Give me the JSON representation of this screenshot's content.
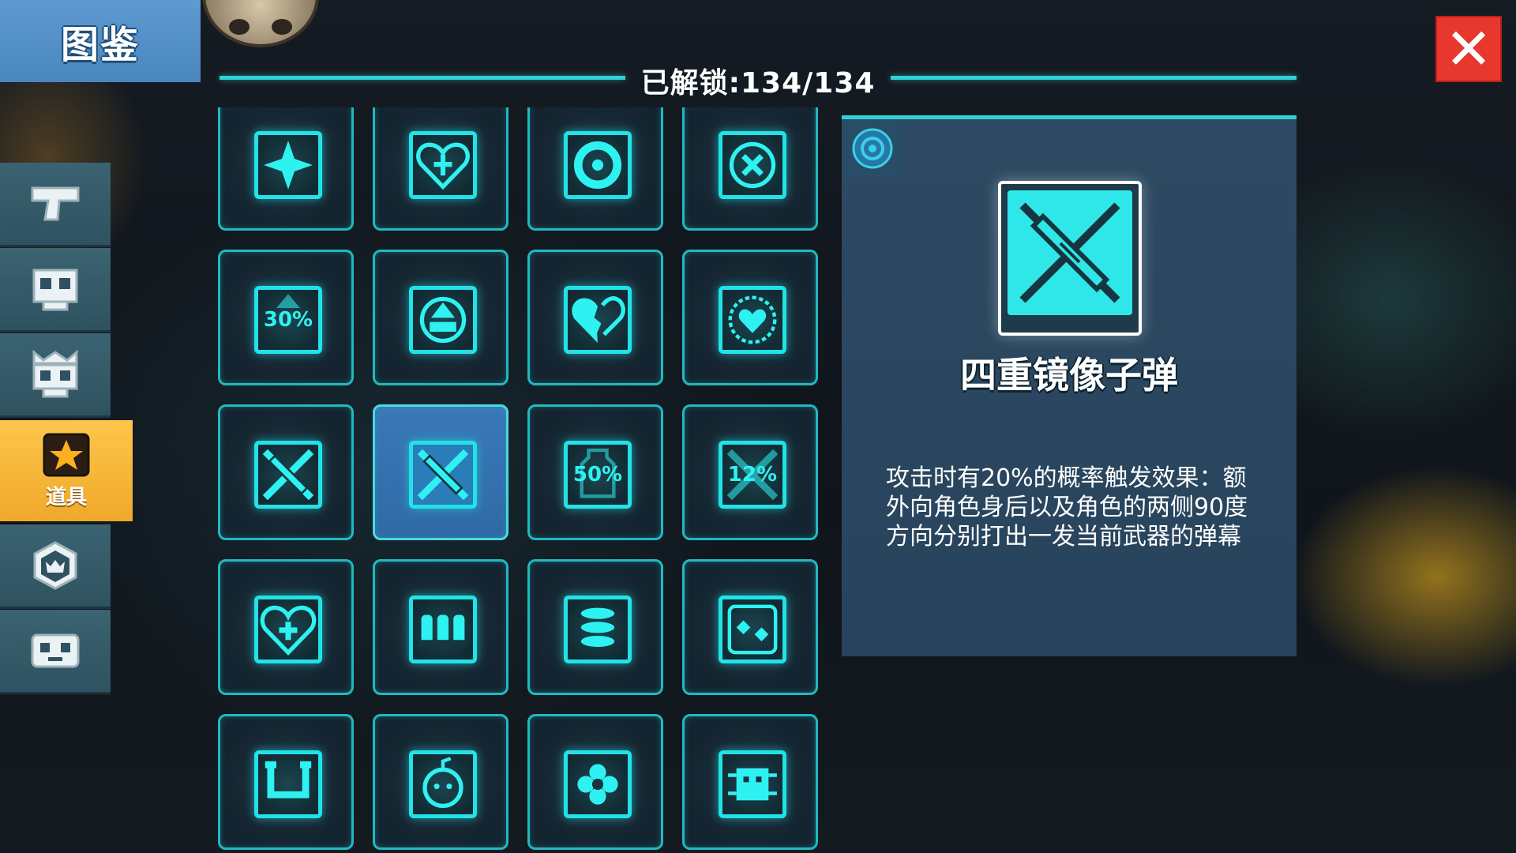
{
  "header": {
    "title": "图鉴",
    "unlock_status": "已解锁:134/134"
  },
  "sidebar": {
    "items": [
      {
        "icon": "pistol-icon",
        "label": ""
      },
      {
        "icon": "skull-icon",
        "label": ""
      },
      {
        "icon": "crowned-skull-icon",
        "label": ""
      },
      {
        "icon": "star-item-icon",
        "label": "道具",
        "active": true
      },
      {
        "icon": "hexagon-crown-icon",
        "label": ""
      },
      {
        "icon": "face-icon",
        "label": ""
      }
    ]
  },
  "grid": {
    "items": [
      {
        "icon": "four-point-star-icon"
      },
      {
        "icon": "heart-cross-icon"
      },
      {
        "icon": "ring-target-icon"
      },
      {
        "icon": "circle-x-icon"
      },
      {
        "icon": "arrow-up-percent-icon",
        "text": "30%"
      },
      {
        "icon": "circle-arrow-icon"
      },
      {
        "icon": "broken-heart-icon"
      },
      {
        "icon": "heart-dial-icon"
      },
      {
        "icon": "crossed-blade-icon"
      },
      {
        "icon": "quad-mirror-bullet-icon",
        "selected": true
      },
      {
        "icon": "bottle-percent-icon",
        "text": "50%"
      },
      {
        "icon": "cross-percent-icon",
        "text": "12%"
      },
      {
        "icon": "heart-plus-icon"
      },
      {
        "icon": "triple-bullet-icon"
      },
      {
        "icon": "stacked-coins-icon"
      },
      {
        "icon": "dice-icon"
      },
      {
        "icon": "magnet-icon"
      },
      {
        "icon": "bomb-face-icon"
      },
      {
        "icon": "flower-icon"
      },
      {
        "icon": "robot-chip-icon"
      }
    ]
  },
  "detail": {
    "name": "四重镜像子弹",
    "description": "攻击时有20%的概率触发效果：额外向角色身后以及角色的两侧90度方向分别打出一发当前武器的弹幕",
    "tag_icon": "ring-emblem-icon",
    "icon": "quad-mirror-bullet-icon"
  },
  "colors": {
    "accent": "#2fd3d3",
    "close": "#e8372d",
    "active_tab": "#f0a82a",
    "title_tab": "#4a86bf"
  }
}
